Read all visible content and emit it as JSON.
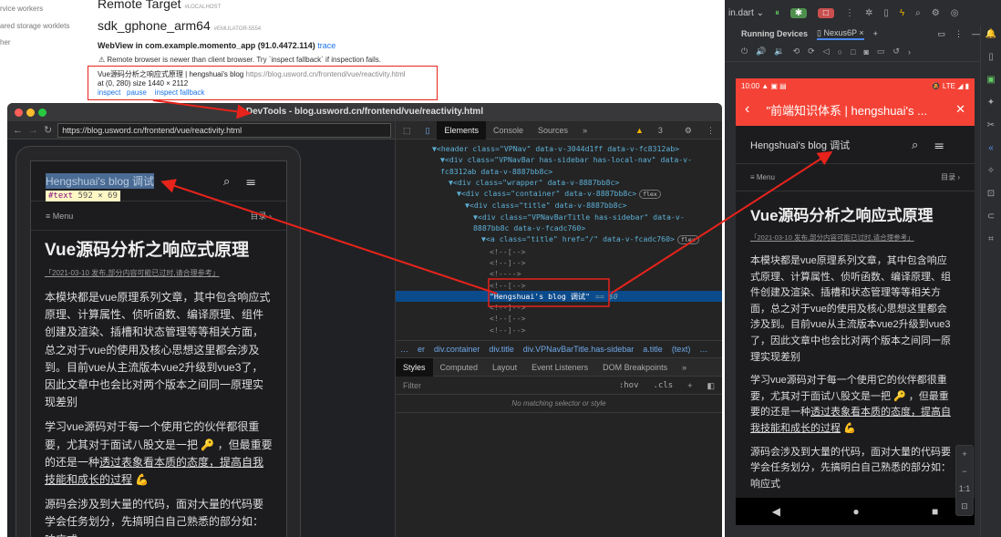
{
  "inspect_page": {
    "sidebar": [
      "rvice workers",
      "ared storage worklets",
      "her"
    ],
    "remote_target": "Remote Target",
    "remote_target_tag": "#LOCALHOST",
    "device": "sdk_gphone_arm64",
    "device_tag": "#EMULATOR-5554",
    "webview": "WebView in com.example.momento_app (91.0.4472.114)",
    "trace": "trace",
    "warning": "⚠ Remote browser is newer than client browser. Try `inspect fallback` if inspection fails.",
    "page_title": "Vue源码分析之响应式原理 | hengshuai's blog",
    "page_url": "https://blog.usword.cn/frontend/vue/reactivity.html",
    "page_geom": "at (0, 280)  size 1440 × 2112",
    "links": [
      "inspect",
      "pause",
      "inspect fallback"
    ]
  },
  "devtools": {
    "title": "DevTools - blog.usword.cn/frontend/vue/reactivity.html",
    "url": "https://blog.usword.cn/frontend/vue/reactivity.html",
    "tabs": [
      "Elements",
      "Console",
      "Sources",
      "»"
    ],
    "warnings": "3",
    "dom": [
      {
        "indent": 0,
        "text": "▼<header class=\"VPNav\" data-v-3044d1ff data-v-fc8312ab>"
      },
      {
        "indent": 1,
        "text": "▼<div class=\"VPNavBar has-sidebar has-local-nav\" data-v-"
      },
      {
        "indent": 1,
        "text": "fc8312ab data-v-8887bb8c>"
      },
      {
        "indent": 2,
        "text": "▼<div class=\"wrapper\" data-v-8887bb8c>"
      },
      {
        "indent": 3,
        "text": "▼<div class=\"container\" data-v-8887bb8c>",
        "badge": "flex"
      },
      {
        "indent": 4,
        "text": "▼<div class=\"title\" data-v-8887bb8c>"
      },
      {
        "indent": 5,
        "text": "▼<div class=\"VPNavBarTitle has-sidebar\" data-v-"
      },
      {
        "indent": 5,
        "text": "8887bb8c data-v-fcadc760>"
      },
      {
        "indent": 6,
        "text": "▼<a class=\"title\" href=\"/\" data-v-fcadc760>",
        "badge": "flex"
      },
      {
        "indent": 7,
        "text": "<!--[-->"
      },
      {
        "indent": 7,
        "text": "<!--]-->"
      },
      {
        "indent": 7,
        "text": "<!---->"
      },
      {
        "indent": 7,
        "text": "<!--[-->"
      },
      {
        "indent": 7,
        "text": "\"Hengshuai's blog 调试\"",
        "selected": true,
        "suffix": "== $0"
      },
      {
        "indent": 7,
        "text": "<!--]-->"
      },
      {
        "indent": 7,
        "text": "<!--[-->"
      },
      {
        "indent": 7,
        "text": "<!--]-->"
      }
    ],
    "breadcrumbs": [
      "…",
      "er",
      "div.container",
      "div.title",
      "div.VPNavBarTitle.has-sidebar",
      "a.title",
      "(text)",
      "…"
    ],
    "style_tabs": [
      "Styles",
      "Computed",
      "Layout",
      "Event Listeners",
      "DOM Breakpoints",
      "»"
    ],
    "filter_placeholder": "Filter",
    "hov": ":hov",
    "cls": ".cls",
    "plus": "+",
    "no_match": "No matching selector or style"
  },
  "blog": {
    "site_title": "Hengshuai's blog 调试",
    "tooltip_tag": "#text",
    "tooltip_size": "592 × 69",
    "menu": "Menu",
    "toc": "目录",
    "heading": "Vue源码分析之响应式原理",
    "date_note": "「2021-03-10 发布,部分内容可能已过时,请合理参考」",
    "p1": "本模块都是vue原理系列文章，其中包含响应式原理、计算属性、侦听函数、编译原理、组件创建及渲染、插槽和状态管理等等相关方面，总之对于vue的使用及核心思想这里都会涉及到。目前vue从主流版本vue2升级到vue3了，因此文章中也会比对两个版本之间同一原理实现差别",
    "p2a": "学习vue源码对于每一个使用它的伙伴都很重要，尤其对于面试八股文是一把 🔑 ，但最重要的还是一种",
    "p2link": "透过表象看本质的态度，提高自我技能和成长的过程",
    "p2b": " 💪",
    "p3": "源码会涉及到大量的代码，面对大量的代码要学会任务划分，先搞明白自己熟悉的部分如：响应式"
  },
  "android_studio": {
    "run_config": "in.dart ⌄",
    "panel_title": "Running Devices",
    "device_tab": "Nexus6P",
    "status_time": "10:00",
    "status_net": "LTE",
    "appbar_title": "\"前端知识体系 | hengshuai's ...",
    "zoom_ratio": "1:1"
  },
  "colors": {
    "annotation": "#e8231b",
    "android_red": "#f44336",
    "selected_row": "#0b4a8b"
  }
}
